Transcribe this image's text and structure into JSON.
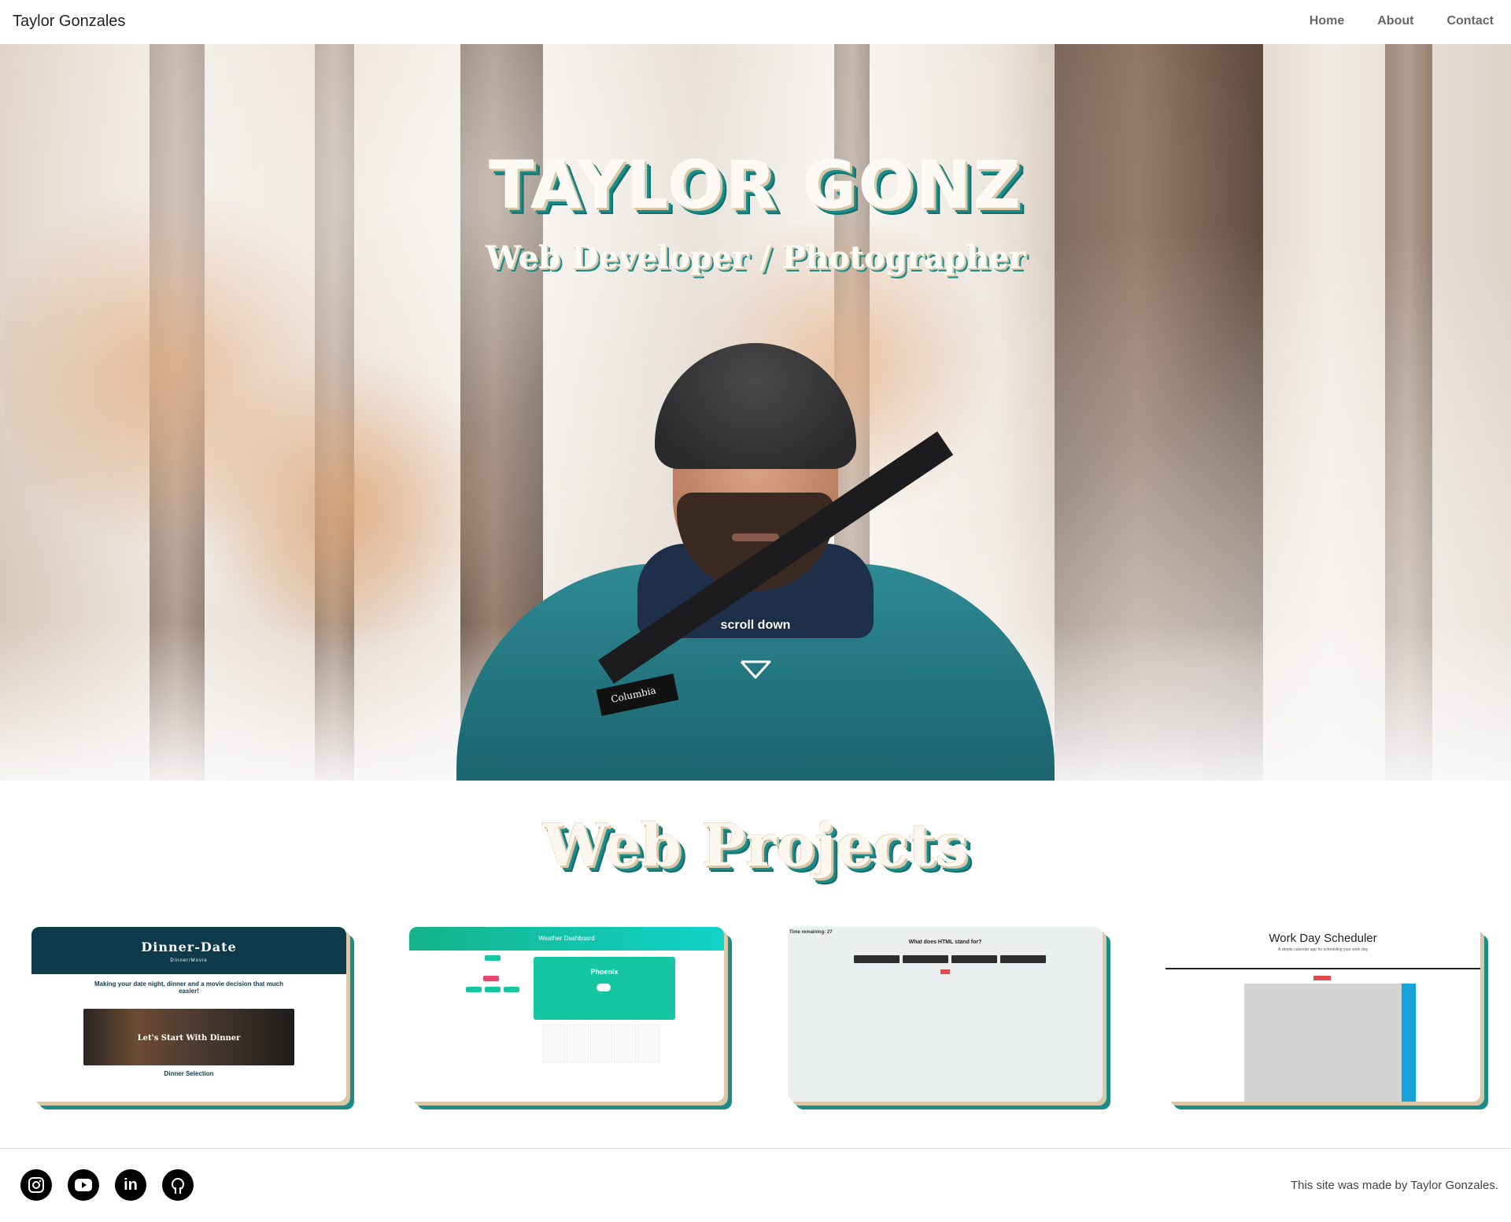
{
  "nav": {
    "brand": "Taylor Gonzales",
    "links": [
      "Home",
      "About",
      "Contact"
    ]
  },
  "hero": {
    "title": "TAYLOR GONZ",
    "subtitle": "Web Developer / Photographer",
    "scroll_label": "scroll down",
    "jacket_patch": "Columbia"
  },
  "projects": {
    "title": "Web Projects",
    "cards": [
      {
        "name": "Dinner-Date",
        "subtitle": "Dinner/Movie",
        "tagline": "Making your date night, dinner and a movie decision that much easier!",
        "image_label": "Let's Start With Dinner",
        "section": "Dinner Selection"
      },
      {
        "name": "Weather Dashboard",
        "city": "Phoenix"
      },
      {
        "name": "Time remaining: 27",
        "question": "What does HTML stand for?"
      },
      {
        "name": "Work Day Scheduler",
        "subtitle": "A simple calendar app for scheduling your work day"
      }
    ]
  },
  "footer": {
    "credit": "This site was made by Taylor Gonzales.",
    "socials": [
      "instagram",
      "youtube",
      "linkedin",
      "github"
    ]
  },
  "colors": {
    "teal_shadow": "#1c8c8a",
    "cream_shadow": "#d9c8a8",
    "card1_header": "#0f3a4c",
    "card2_header": "#14b38a",
    "scheduler_blue": "#17a3d8"
  }
}
